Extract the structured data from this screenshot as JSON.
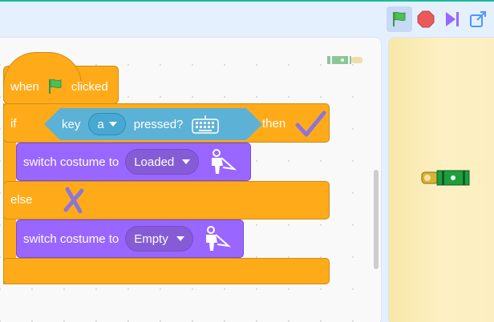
{
  "controls": {
    "green_flag": "green-flag-icon",
    "stop": "stop-icon",
    "step": "step-icon",
    "fullscreen": "fullscreen-icon"
  },
  "blocks": {
    "hat": {
      "when": "when",
      "clicked": "clicked"
    },
    "if": {
      "if": "if",
      "then": "then",
      "else": "else"
    },
    "sensing": {
      "key": "key",
      "key_value": "a",
      "pressed": "pressed?"
    },
    "looks1": {
      "label": "switch costume to",
      "value": "Loaded"
    },
    "looks2": {
      "label": "switch costume to",
      "value": "Empty"
    }
  },
  "colors": {
    "events": "#ffab19",
    "control": "#ffab19",
    "sensing": "#5cb1d6",
    "looks": "#9966ff",
    "stage_bg": "#fdf0c4"
  }
}
